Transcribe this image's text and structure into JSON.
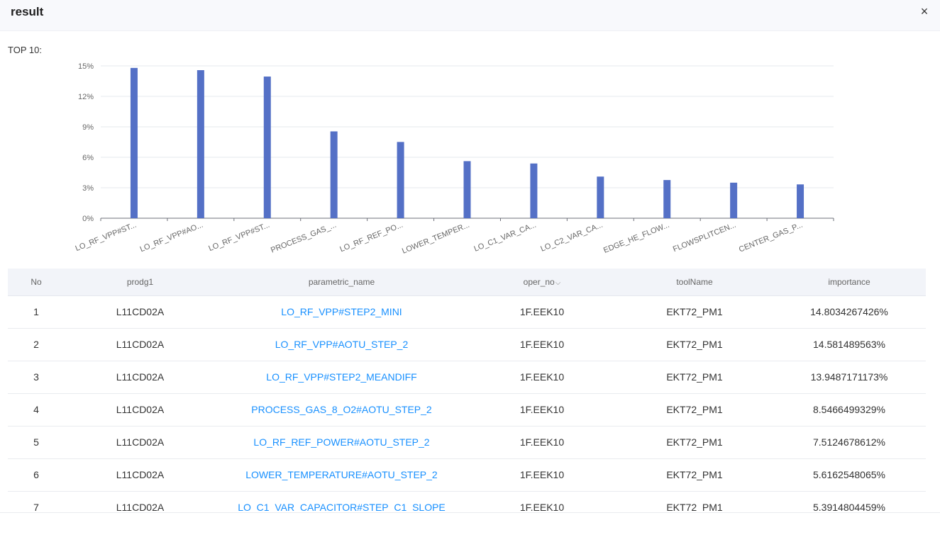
{
  "dialog": {
    "title": "result",
    "close_icon": "×"
  },
  "section": {
    "label": "TOP 10:"
  },
  "chart_data": {
    "type": "bar",
    "title": "",
    "xlabel": "",
    "ylabel": "",
    "ylim": [
      0,
      15
    ],
    "yticks": [
      "0%",
      "3%",
      "6%",
      "9%",
      "12%",
      "15%"
    ],
    "grid": true,
    "color": "#5470c6",
    "categories": [
      "LO_RF_VPP#ST...",
      "LO_RF_VPP#AO...",
      "LO_RF_VPP#ST...",
      "PROCESS_GAS_...",
      "LO_RF_REF_PO...",
      "LOWER_TEMPER...",
      "LO_C1_VAR_CA...",
      "LO_C2_VAR_CA...",
      "EDGE_HE_FLOW...",
      "FLOWSPLITCEN...",
      "CENTER_GAS_P..."
    ],
    "values": [
      14.8,
      14.58,
      13.95,
      8.55,
      7.51,
      5.62,
      5.39,
      4.1,
      3.76,
      3.5,
      3.33
    ]
  },
  "table": {
    "columns": [
      "No",
      "prodg1",
      "parametric_name",
      "oper_no",
      "toolName",
      "importance"
    ],
    "sort_icon": "⌵",
    "rows": [
      [
        "1",
        "L11CD02A",
        "LO_RF_VPP#STEP2_MINI",
        "1F.EEK10",
        "EKT72_PM1",
        "14.8034267426%"
      ],
      [
        "2",
        "L11CD02A",
        "LO_RF_VPP#AOTU_STEP_2",
        "1F.EEK10",
        "EKT72_PM1",
        "14.581489563%"
      ],
      [
        "3",
        "L11CD02A",
        "LO_RF_VPP#STEP2_MEANDIFF",
        "1F.EEK10",
        "EKT72_PM1",
        "13.9487171173%"
      ],
      [
        "4",
        "L11CD02A",
        "PROCESS_GAS_8_O2#AOTU_STEP_2",
        "1F.EEK10",
        "EKT72_PM1",
        "8.5466499329%"
      ],
      [
        "5",
        "L11CD02A",
        "LO_RF_REF_POWER#AOTU_STEP_2",
        "1F.EEK10",
        "EKT72_PM1",
        "7.5124678612%"
      ],
      [
        "6",
        "L11CD02A",
        "LOWER_TEMPERATURE#AOTU_STEP_2",
        "1F.EEK10",
        "EKT72_PM1",
        "5.6162548065%"
      ],
      [
        "7",
        "L11CD02A",
        "LO_C1_VAR_CAPACITOR#STEP_C1_SLOPE",
        "1F.EEK10",
        "EKT72_PM1",
        "5.3914804459%"
      ]
    ]
  }
}
